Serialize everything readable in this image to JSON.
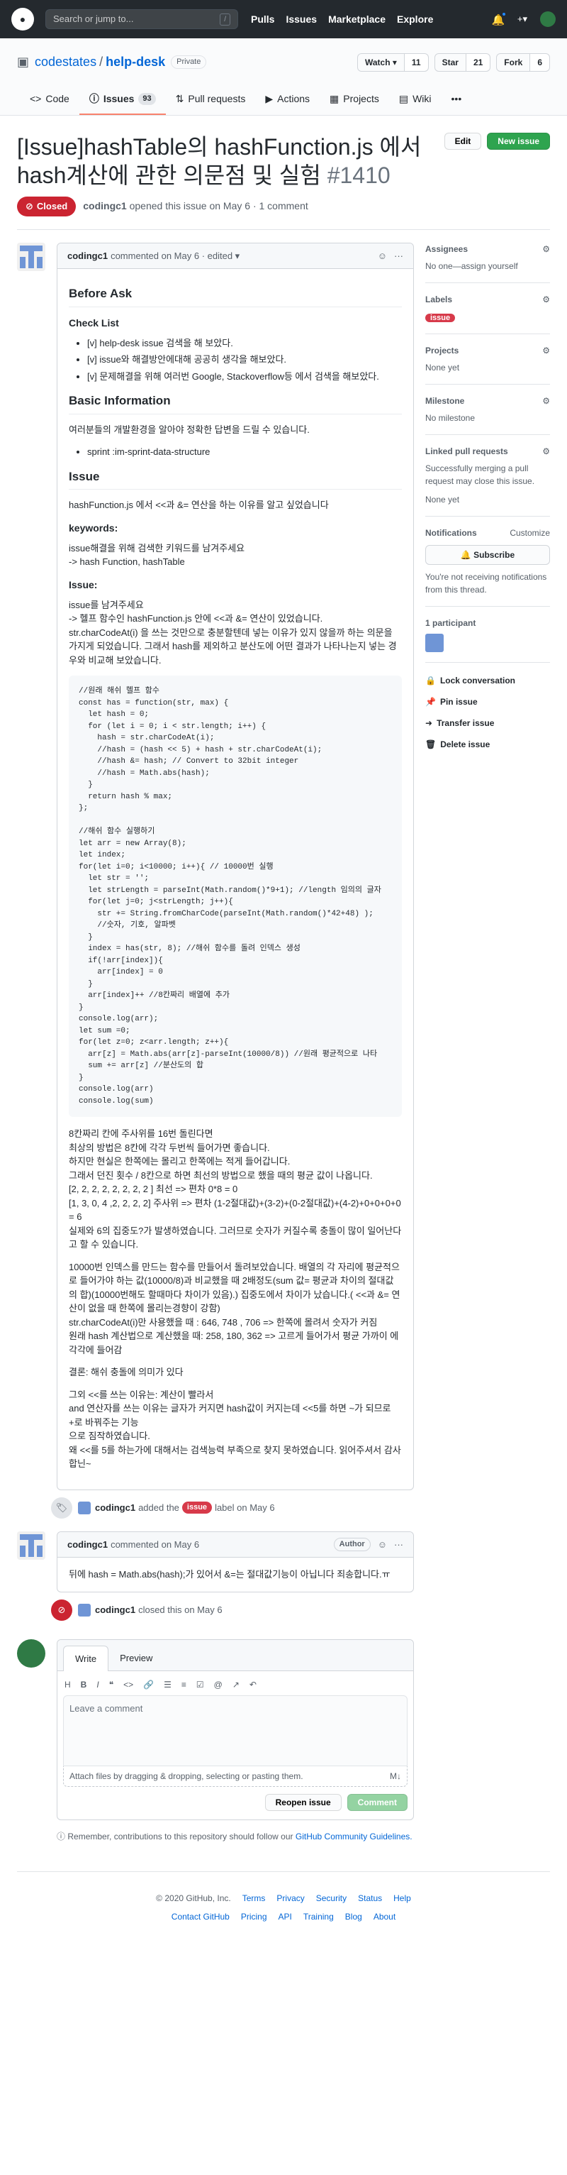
{
  "header": {
    "search_placeholder": "Search or jump to...",
    "search_shortcut": "/",
    "nav": [
      "Pulls",
      "Issues",
      "Marketplace",
      "Explore"
    ],
    "plus": "+▾"
  },
  "repo": {
    "owner": "codestates",
    "sep": "/",
    "name": "help-desk",
    "visibility": "Private",
    "watch_label": "Watch ▾",
    "watch_count": "11",
    "star_label": "Star",
    "star_count": "21",
    "fork_label": "Fork",
    "fork_count": "6"
  },
  "tabs": [
    {
      "label": "Code",
      "icon": "<>"
    },
    {
      "label": "Issues",
      "icon": "ⓘ",
      "count": "93"
    },
    {
      "label": "Pull requests",
      "icon": "⇅"
    },
    {
      "label": "Actions",
      "icon": "▶"
    },
    {
      "label": "Projects",
      "icon": "▦"
    },
    {
      "label": "Wiki",
      "icon": "▤"
    }
  ],
  "tab_more": "•••",
  "issue": {
    "title": "[Issue]hashTable의 hashFunction.js 에서 hash계산에 관한 의문점 및 실험",
    "number": "#1410",
    "edit_label": "Edit",
    "new_label": "New issue",
    "state": "Closed",
    "author": "codingc1",
    "opened_text": "opened this issue on May 6 · 1 comment"
  },
  "comment1": {
    "author": "codingc1",
    "meta": "commented on May 6 · edited ▾",
    "h_before": "Before Ask",
    "h_checklist": "Check List",
    "checklist": [
      "[v] help-desk issue 검색을 해 보았다.",
      "[v] issue와 해결방안에대해 공공히 생각을 해보았다.",
      "[v] 문제해결을 위해 여러번 Google, Stackoverflow등 에서 검색을 해보았다."
    ],
    "h_basic": "Basic Information",
    "basic_p": "여러분들의 개발환경을 알아야 정확한 답변을 드릴 수 있습니다.",
    "sprint": "sprint :im-sprint-data-structure",
    "h_issue": "Issue",
    "issue_p": "hashFunction.js 에서 <<과 &= 연산을 하는 이유를 알고 싶었습니다",
    "h_keywords": "keywords:",
    "keywords_p1": "issue해결을 위해 검색한 키워드를 남겨주세요",
    "keywords_p2": "-> hash Function, hashTable",
    "h_issue2": "Issue:",
    "issue2_p1": "issue를 남겨주세요",
    "issue2_p2": "-> 헬프 함수인 hashFunction.js 안에 <<과 &= 연산이 있었습니다.",
    "issue2_p3": "str.charCodeAt(i) 을 쓰는 것만으로 충분할텐데 넣는 이유가 있지 않을까 하는 의문을 가지게 되었습니다. 그래서 hash를 제외하고 분산도에 어떤 결과가 나타나는지 넣는 경우와 비교해 보았습니다.",
    "code": "//원래 해쉬 헬프 함수\nconst has = function(str, max) {\n  let hash = 0;\n  for (let i = 0; i < str.length; i++) {\n    hash = str.charCodeAt(i);\n    //hash = (hash << 5) + hash + str.charCodeAt(i);\n    //hash &= hash; // Convert to 32bit integer\n    //hash = Math.abs(hash);\n  }\n  return hash % max;\n};\n\n//해쉬 함수 실행하기\nlet arr = new Array(8);\nlet index;\nfor(let i=0; i<10000; i++){ // 10000번 실행\n  let str = '';\n  let strLength = parseInt(Math.random()*9+1); //length 임의의 글자\n  for(let j=0; j<strLength; j++){\n    str += String.fromCharCode(parseInt(Math.random()*42+48) );\n    //숫자, 기호, 알파벳\n  }\n  index = has(str, 8); //해쉬 함수를 돌려 인덱스 생성\n  if(!arr[index]){\n    arr[index] = 0\n  }\n  arr[index]++ //8칸짜리 배열에 추가\n}\nconsole.log(arr);\nlet sum =0;\nfor(let z=0; z<arr.length; z++){\n  arr[z] = Math.abs(arr[z]-parseInt(10000/8)) //원래 평균적으로 나타\n  sum += arr[z] //분산도의 합\n}\nconsole.log(arr)\nconsole.log(sum)",
    "after_code": [
      "8칸짜리 칸에 주사위를 16번 돌린다면",
      "최상의 방법은 8칸에 각각 두번씩 들어가면 좋습니다.",
      "하지만 현실은 한쪽에는 몰리고 한쪽에는 적게 들어갑니다.",
      "그래서 던진 횟수 / 8칸으로 하면 최선의 방법으로 했을 때의 평균 값이 나옵니다.",
      "[2, 2, 2, 2, 2, 2, 2, 2 ] 최선 => 편차 0*8 = 0",
      "[1, 3, 0, 4 ,2, 2, 2, 2] 주사위 => 편차 (1-2절대값)+(3-2)+(0-2절대값)+(4-2)+0+0+0+0 = 6",
      "실제와 6의 집중도?가 발생하였습니다. 그러므로 숫자가 커질수록 충돌이 많이 일어난다고 할 수 있습니다."
    ],
    "para2": [
      "10000번 인덱스를 만드는 함수를 만들어서 돌려보았습니다. 배열의 각 자리에 평균적으로 들어가야 하는 값(10000/8)과 비교했을 때 2배정도(sum 값= 평균과 차이의 절대값의 합)(10000번해도 할때마다 차이가 있음).) 집중도에서 차이가 났습니다.( <<과 &= 연산이 없을 때 한쪽에 몰리는경향이 강함)",
      "str.charCodeAt(i)만 사용했을 때 : 646, 748 , 706 => 한쪽에 몰려서 숫자가 커짐",
      "원래 hash 계산법으로 계산했을 때: 258, 180, 362 => 고르게 들어가서 평균 가까이 에 각각에 들어감"
    ],
    "conclusion": "결론: 해쉬 충돌에 의미가 있다",
    "para3": [
      "그외 <<를 쓰는 이유는: 계산이 빨라서",
      "and 연산자를 쓰는 이유는 글자가 커지면 hash값이 커지는데 <<5를 하면 ~가 되므로 +로 바꿔주는 기능",
      "으로 짐작하였습니다.",
      "왜 <<를 5를 하는가에 대해서는 검색능력 부족으로 찾지 못하였습니다. 읽어주셔서 감사합닌~"
    ]
  },
  "event_label": {
    "author": "codingc1",
    "pre": "added the",
    "label": "issue",
    "post": "label on May 6"
  },
  "comment2": {
    "author": "codingc1",
    "meta": "commented on May 6",
    "tag": "Author",
    "body": "뒤에 hash = Math.abs(hash);가 있어서 &=는 절대값기능이 아닙니다 죄송합니다.ㅠ"
  },
  "event_closed": {
    "author": "codingc1",
    "text": "closed this on May 6"
  },
  "editor": {
    "tab_write": "Write",
    "tab_preview": "Preview",
    "placeholder": "Leave a comment",
    "attach": "Attach files by dragging & dropping, selecting or pasting them.",
    "md": "M↓",
    "reopen": "Reopen issue",
    "comment": "Comment"
  },
  "remember": {
    "text": "Remember, contributions to this repository should follow our ",
    "link": "GitHub Community Guidelines."
  },
  "sidebar": {
    "assignees_h": "Assignees",
    "assignees_v": "No one—assign yourself",
    "labels_h": "Labels",
    "labels_v": "issue",
    "projects_h": "Projects",
    "projects_v": "None yet",
    "milestone_h": "Milestone",
    "milestone_v": "No milestone",
    "linked_h": "Linked pull requests",
    "linked_v": "Successfully merging a pull request may close this issue.",
    "linked_v2": "None yet",
    "notif_h": "Notifications",
    "notif_custom": "Customize",
    "subscribe": "Subscribe",
    "notif_v": "You're not receiving notifications from this thread.",
    "participants_h": "1 participant",
    "lock": "Lock conversation",
    "pin": "Pin issue",
    "transfer": "Transfer issue",
    "delete": "Delete issue"
  },
  "footer": {
    "copy": "© 2020 GitHub, Inc.",
    "row1": [
      "Terms",
      "Privacy",
      "Security",
      "Status",
      "Help"
    ],
    "row2": [
      "Contact GitHub",
      "Pricing",
      "API",
      "Training",
      "Blog",
      "About"
    ]
  },
  "colors": {
    "accent": "#0366d6",
    "closed": "#cb2431",
    "green": "#2ea44f",
    "label": "#d73a4a"
  }
}
